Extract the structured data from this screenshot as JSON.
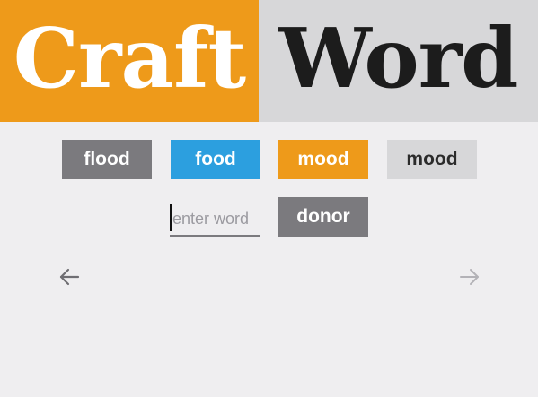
{
  "header": {
    "logo_left": "Craft",
    "logo_right": "Word"
  },
  "word_chain": [
    {
      "word": "flood",
      "color": "#7b7a7e"
    },
    {
      "word": "food",
      "color": "#2c9fdf"
    },
    {
      "word": "mood",
      "color": "#ee9a1a"
    },
    {
      "word": "mood",
      "color": "#d7d7d9"
    }
  ],
  "input": {
    "value": "",
    "placeholder": "enter word"
  },
  "suggestion": {
    "label": "donor"
  },
  "navigation": {
    "prev_icon": "arrow-left-icon",
    "next_icon": "arrow-right-icon"
  },
  "colors": {
    "brand_orange": "#ee9a1a",
    "brand_gray": "#d7d7d9",
    "accent_blue": "#2c9fdf",
    "tile_gray": "#7b7a7e",
    "background": "#efeef0"
  }
}
